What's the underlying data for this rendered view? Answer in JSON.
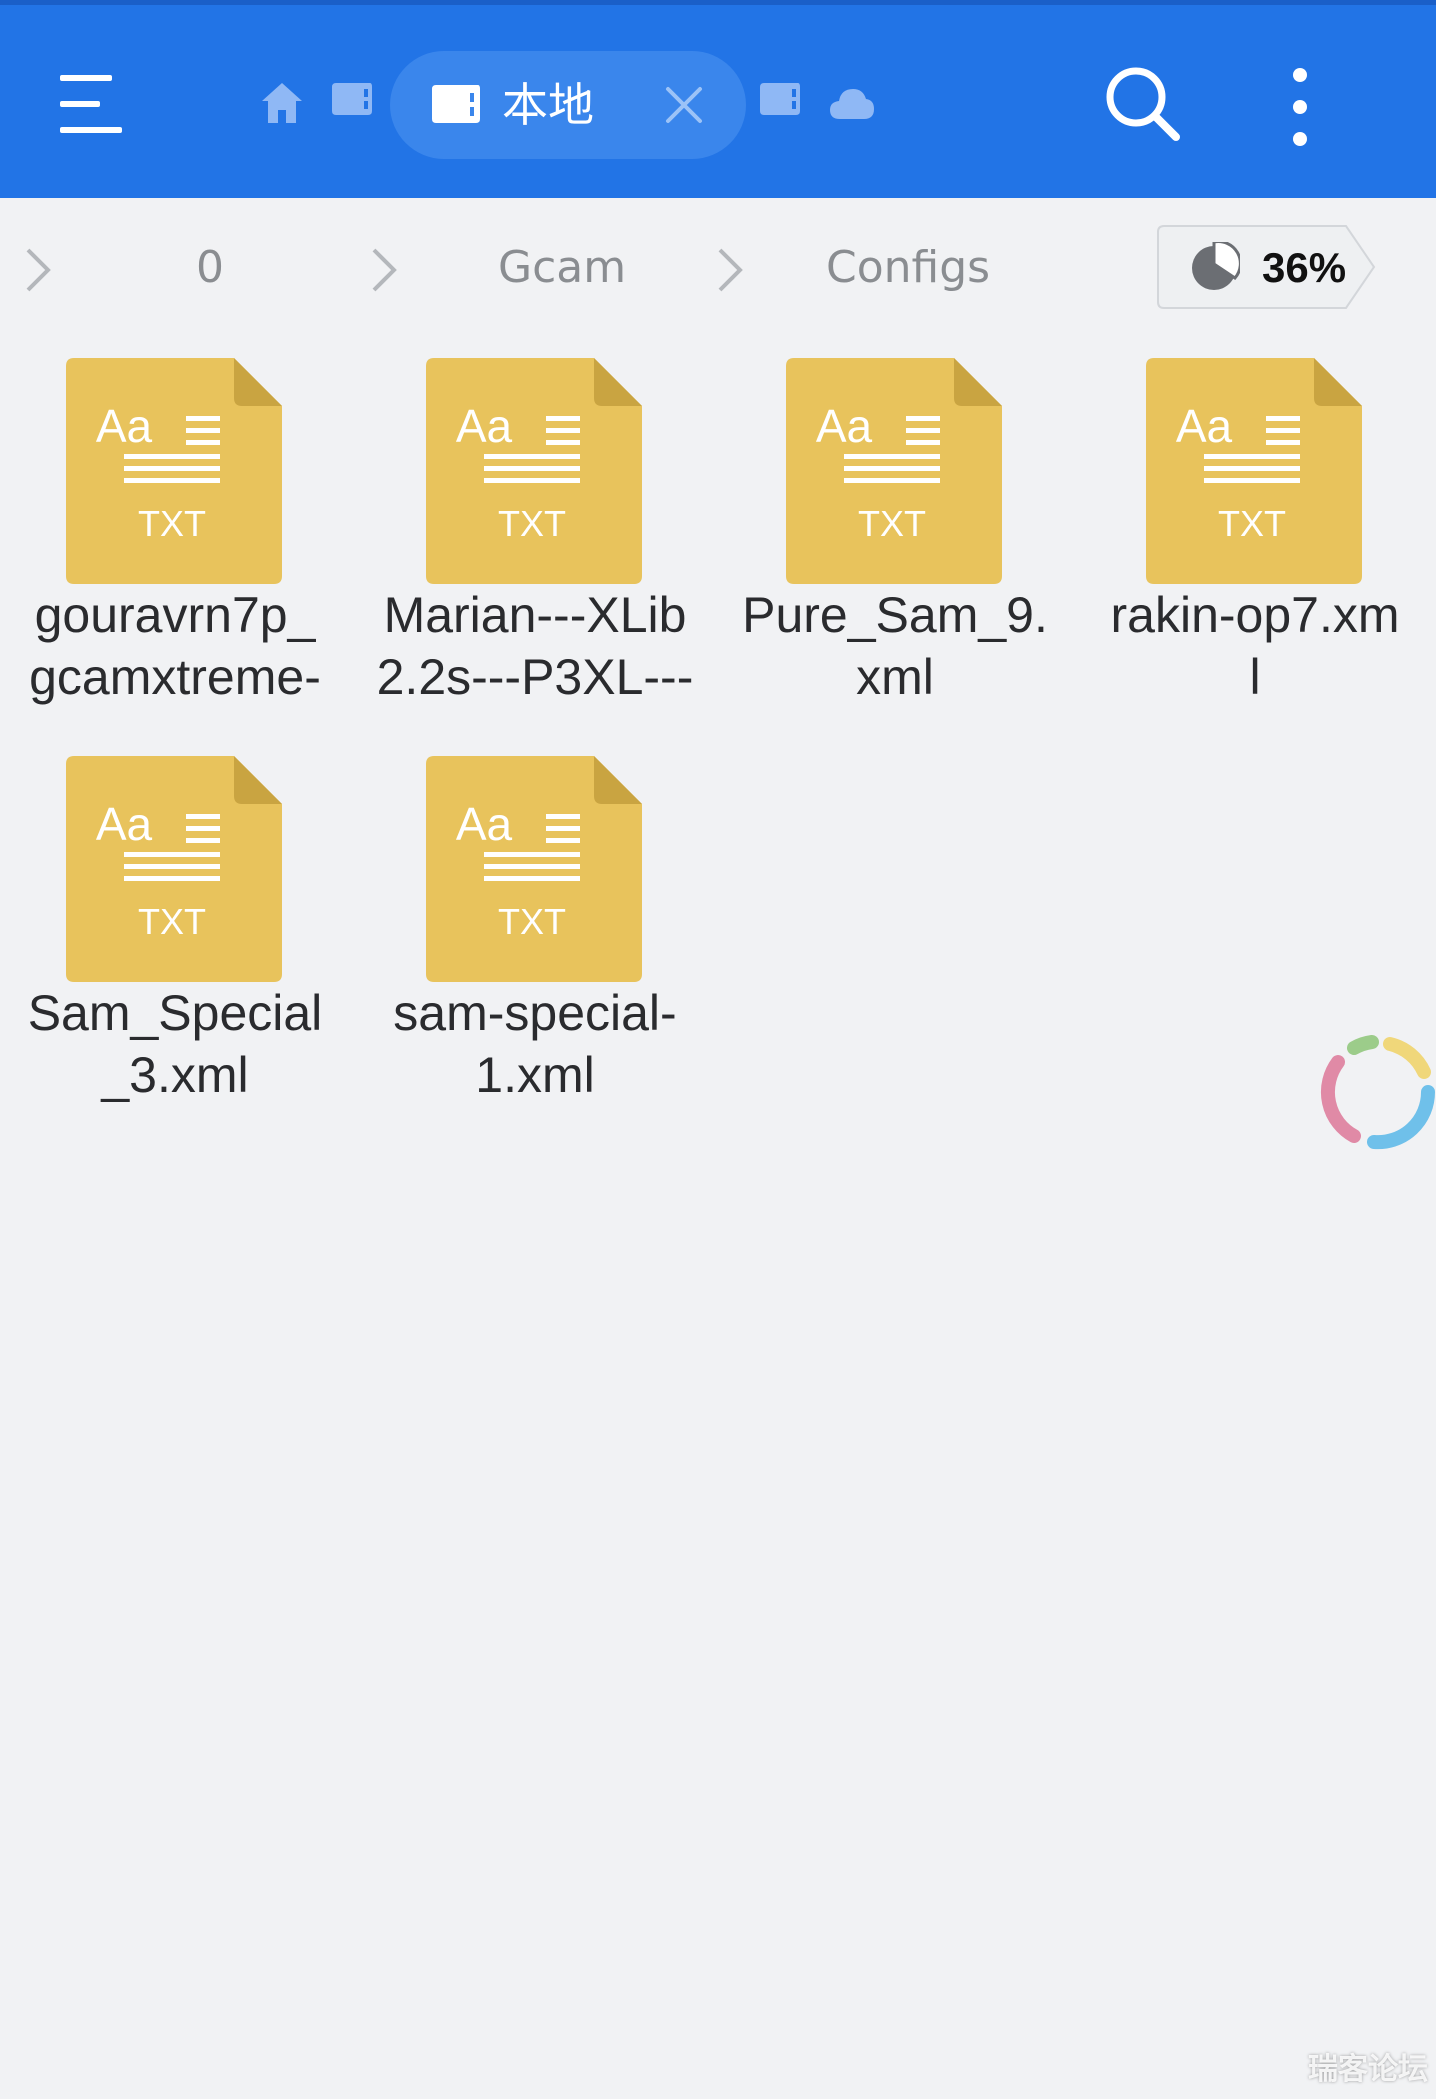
{
  "toolbar": {
    "menu_icon": "menu-icon",
    "tabs": [
      {
        "icon": "home-icon"
      },
      {
        "icon": "sd-card-icon"
      },
      {
        "icon": "sd-card-icon",
        "label": "本地",
        "active": true,
        "close_icon": "close-icon"
      },
      {
        "icon": "sd-card-icon"
      },
      {
        "icon": "cloud-icon"
      }
    ],
    "search_icon": "search-icon",
    "more_icon": "more-vertical-icon",
    "colors": {
      "bar": "#2274e6",
      "active_tab": "#3a86ec"
    }
  },
  "breadcrumb": {
    "items": [
      "0",
      "Gcam",
      "Configs"
    ],
    "storage_percent": "36%",
    "storage_fraction": 0.36
  },
  "files": [
    {
      "type": "TXT",
      "glyph": "Aa",
      "name": "gouravrn7p_\ngcamxtreme-"
    },
    {
      "type": "TXT",
      "glyph": "Aa",
      "name": "Marian---XLib\n2.2s---P3XL---"
    },
    {
      "type": "TXT",
      "glyph": "Aa",
      "name": "Pure_Sam_9.\nxml"
    },
    {
      "type": "TXT",
      "glyph": "Aa",
      "name": "rakin-op7.xm\nl"
    },
    {
      "type": "TXT",
      "glyph": "Aa",
      "name": "Sam_Special\n_3.xml"
    },
    {
      "type": "TXT",
      "glyph": "Aa",
      "name": "sam-special-\n1.xml"
    }
  ],
  "file_icon_color": "#e8c35c",
  "loader_icon": "loading-spinner-icon",
  "watermark": "瑞客论坛"
}
